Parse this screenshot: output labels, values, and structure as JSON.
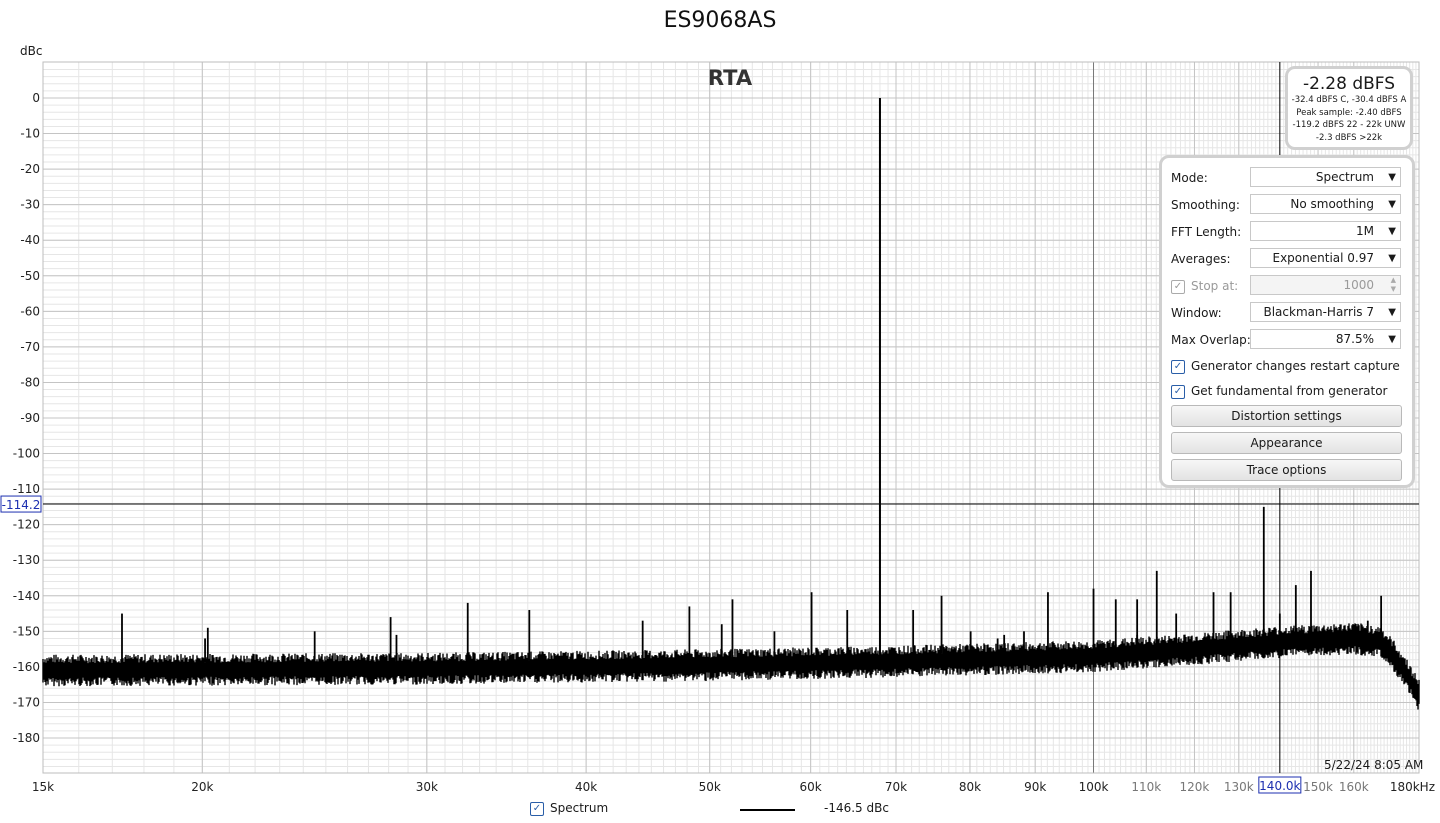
{
  "window": {
    "title": "ES9068AS",
    "graph_label": "RTA",
    "unit_label": "dBc",
    "timestamp": "5/22/24 8:05 AM"
  },
  "readout": {
    "level": "-2.28 dBFS",
    "weighted": "-32.4 dBFS C, -30.4 dBFS A",
    "peak": "Peak sample: -2.40 dBFS",
    "unweighted": "-119.2 dBFS 22 - 22k UNW",
    "above": "-2.3 dBFS >22k"
  },
  "controls": {
    "mode_label": "Mode:",
    "mode_value": "Spectrum",
    "smoothing_label": "Smoothing:",
    "smoothing_value": "No smoothing",
    "fft_label": "FFT Length:",
    "fft_value": "1M",
    "averages_label": "Averages:",
    "averages_value": "Exponential 0.97",
    "stop_label": "Stop at:",
    "stop_value": "1000",
    "window_label": "Window:",
    "window_value": "Blackman-Harris 7",
    "overlap_label": "Max Overlap:",
    "overlap_value": "87.5%",
    "gen_restart_label": "Generator changes restart capture",
    "gen_fund_label": "Get fundamental from generator",
    "distortion_button": "Distortion settings",
    "appearance_button": "Appearance",
    "trace_button": "Trace options"
  },
  "legend": {
    "series_name": "Spectrum",
    "cursor_value": "-146.5 dBc",
    "check_glyph": "✓"
  },
  "cursor": {
    "y_readout": "-114.2",
    "x_readout": "140.0k",
    "y_value": -114.2,
    "x_value": 140000
  },
  "colors": {
    "trace": "#000000",
    "cursor_box": "#1c2fb0",
    "grid_major": "#c4c4c4",
    "grid_minor": "#e6e6e6",
    "checkbox": "#2a5ea8"
  },
  "chart_data": {
    "type": "line",
    "title": "ES9068AS",
    "subtitle": "RTA",
    "xlabel": "",
    "ylabel": "dBc",
    "x_scale": "log",
    "xlim": [
      15000,
      180000
    ],
    "ylim": [
      -190,
      10
    ],
    "grid": true,
    "x_ticks": [
      {
        "value": 15000,
        "label": "15k",
        "major": true
      },
      {
        "value": 20000,
        "label": "20k",
        "major": true
      },
      {
        "value": 30000,
        "label": "30k",
        "major": true
      },
      {
        "value": 40000,
        "label": "40k",
        "major": true
      },
      {
        "value": 50000,
        "label": "50k",
        "major": true
      },
      {
        "value": 60000,
        "label": "60k",
        "major": true
      },
      {
        "value": 70000,
        "label": "70k",
        "major": true
      },
      {
        "value": 80000,
        "label": "80k",
        "major": true
      },
      {
        "value": 90000,
        "label": "90k",
        "major": true
      },
      {
        "value": 100000,
        "label": "100k",
        "major": true
      },
      {
        "value": 110000,
        "label": "110k",
        "major": false
      },
      {
        "value": 120000,
        "label": "120k",
        "major": false
      },
      {
        "value": 130000,
        "label": "130k",
        "major": false
      },
      {
        "value": 150000,
        "label": "150k",
        "major": false
      },
      {
        "value": 160000,
        "label": "160k",
        "major": false
      },
      {
        "value": 180000,
        "label": "180kHz",
        "major": true
      }
    ],
    "y_ticks": [
      0,
      -10,
      -20,
      -30,
      -40,
      -50,
      -60,
      -70,
      -80,
      -90,
      -100,
      -110,
      -120,
      -130,
      -140,
      -150,
      -160,
      -170,
      -180
    ],
    "noise_floor": [
      [
        15000,
        -161
      ],
      [
        30000,
        -160.5
      ],
      [
        50000,
        -159.5
      ],
      [
        70000,
        -158.5
      ],
      [
        100000,
        -157
      ],
      [
        120000,
        -155
      ],
      [
        140000,
        -153
      ],
      [
        160000,
        -152
      ],
      [
        168000,
        -153
      ],
      [
        172000,
        -157
      ],
      [
        176000,
        -162
      ],
      [
        180000,
        -168
      ]
    ],
    "peaks": [
      [
        17300,
        -145
      ],
      [
        20100,
        -152
      ],
      [
        20200,
        -149
      ],
      [
        24500,
        -150
      ],
      [
        28100,
        -146
      ],
      [
        28400,
        -151
      ],
      [
        32300,
        -142
      ],
      [
        36100,
        -144
      ],
      [
        44300,
        -147
      ],
      [
        48200,
        -143
      ],
      [
        51100,
        -148
      ],
      [
        52100,
        -141
      ],
      [
        56200,
        -150
      ],
      [
        60100,
        -139
      ],
      [
        64100,
        -144
      ],
      [
        68000,
        0
      ],
      [
        72200,
        -144
      ],
      [
        76000,
        -140
      ],
      [
        80100,
        -150
      ],
      [
        84100,
        -152
      ],
      [
        85100,
        -151
      ],
      [
        88200,
        -150
      ],
      [
        92100,
        -139
      ],
      [
        100000,
        -138
      ],
      [
        104100,
        -141
      ],
      [
        108200,
        -151
      ],
      [
        108200,
        -141
      ],
      [
        112100,
        -133
      ],
      [
        116100,
        -145
      ],
      [
        124200,
        -139
      ],
      [
        128100,
        -139
      ],
      [
        136000,
        -115
      ],
      [
        140000,
        -145
      ],
      [
        144100,
        -137
      ],
      [
        148100,
        -133
      ],
      [
        164100,
        -147
      ],
      [
        168100,
        -140
      ]
    ],
    "series": [
      {
        "name": "Spectrum"
      }
    ]
  }
}
